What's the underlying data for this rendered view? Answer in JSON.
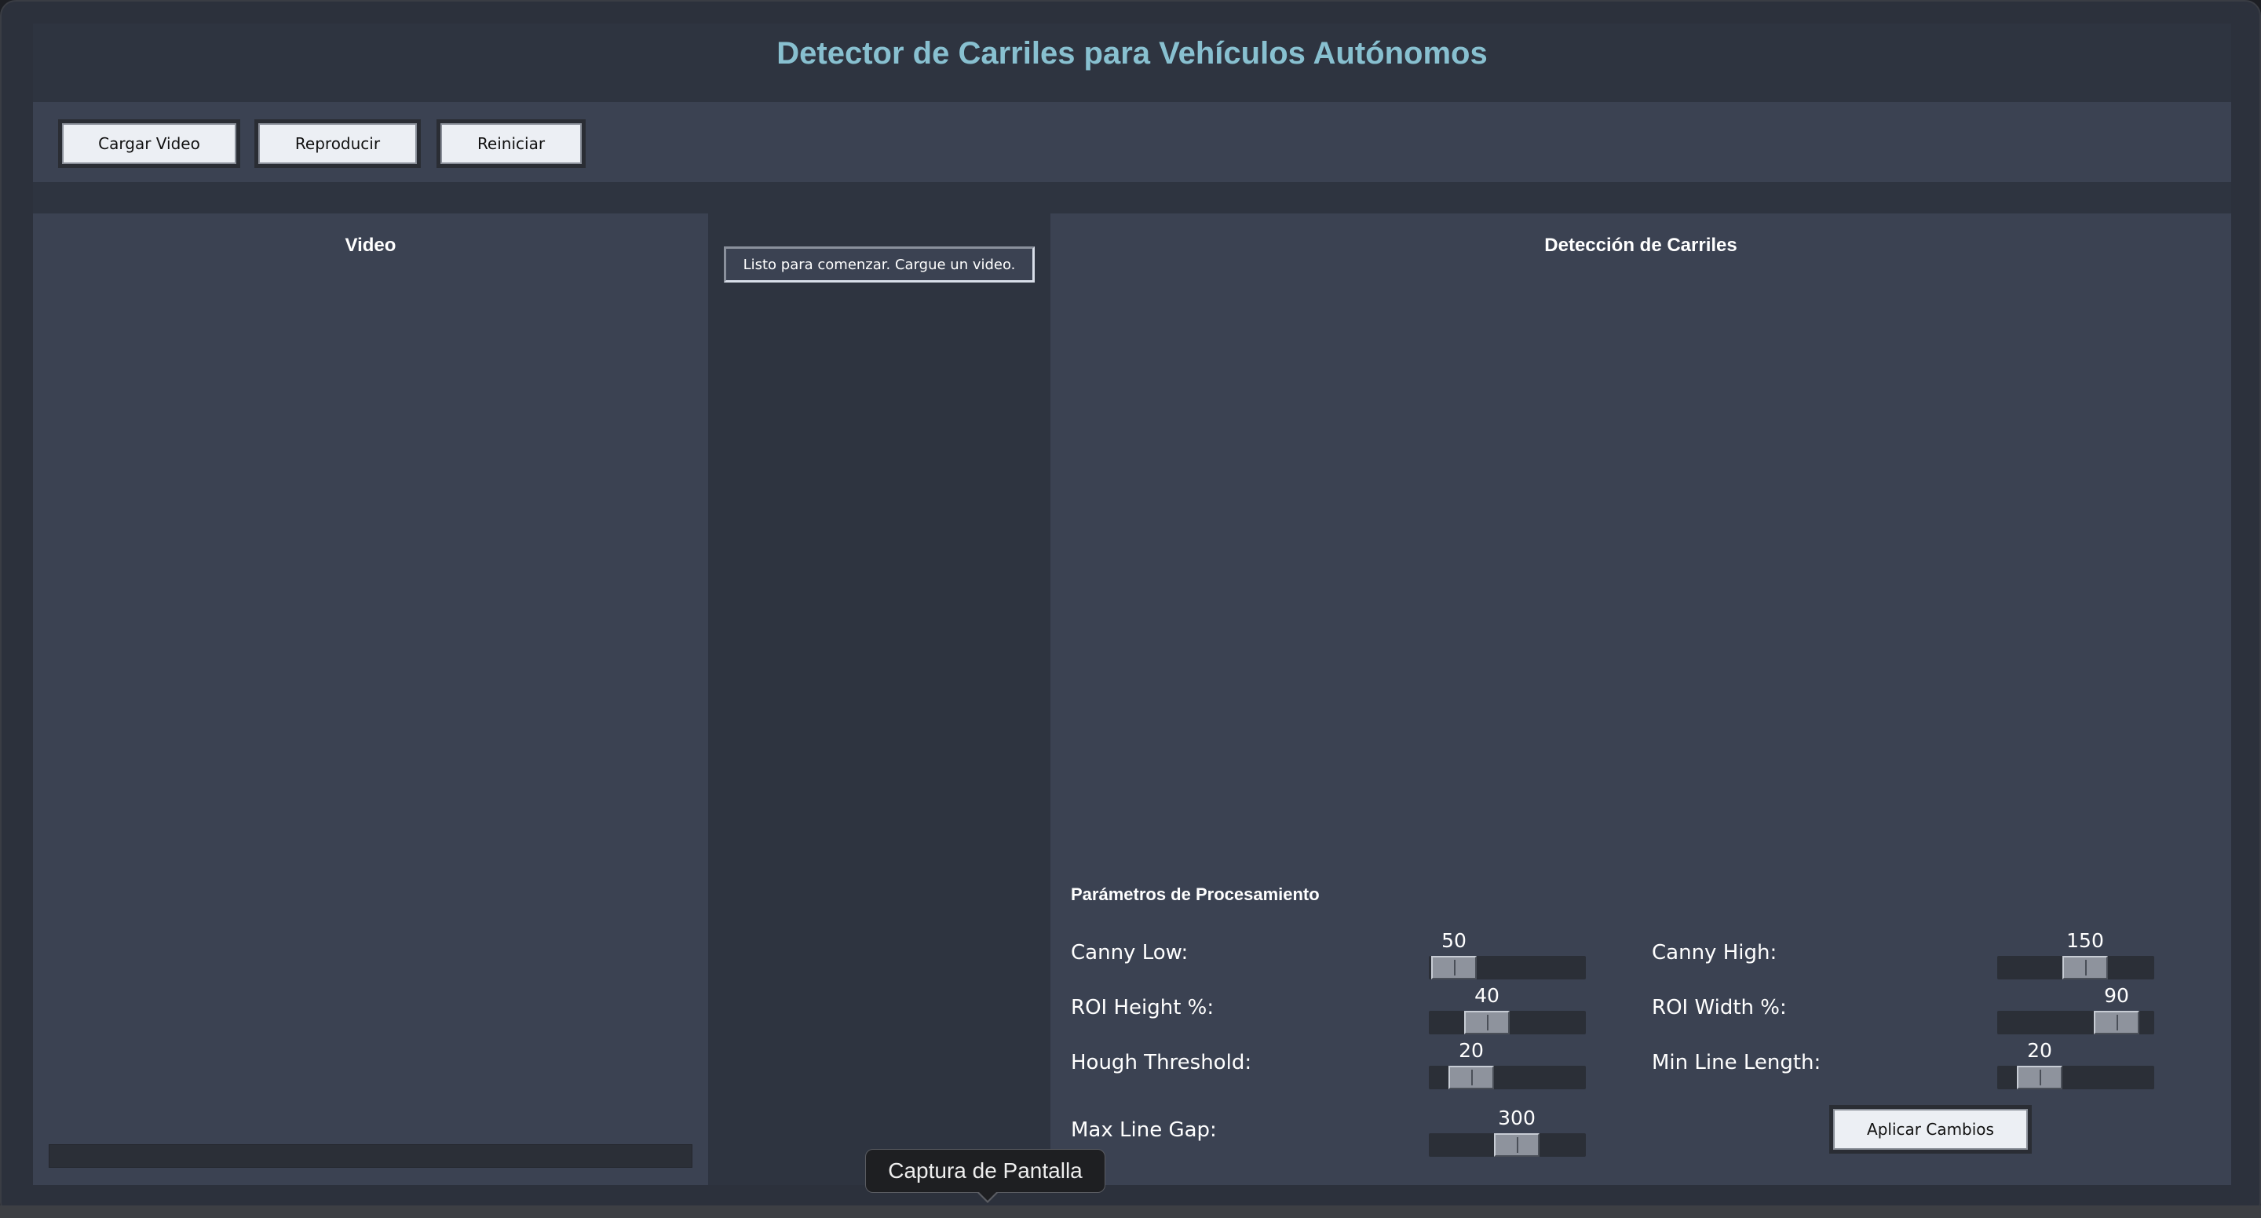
{
  "app": {
    "title": "Detector de Carriles para Vehículos Autónomos"
  },
  "toolbar": {
    "load_label": "Cargar Video",
    "play_label": "Reproducir",
    "reset_label": "Reiniciar"
  },
  "video_panel": {
    "title": "Video",
    "progress": 0
  },
  "status": {
    "text": "Listo para comenzar. Cargue un video."
  },
  "detection_panel": {
    "title": "Detección de Carriles"
  },
  "params": {
    "heading": "Parámetros de Procesamiento",
    "canny_low": {
      "label": "Canny Low:",
      "value": "50",
      "min": 0,
      "max": 255,
      "fraction": 0.16
    },
    "canny_high": {
      "label": "Canny High:",
      "value": "150",
      "min": 0,
      "max": 255,
      "fraction": 0.56
    },
    "roi_height": {
      "label": "ROI Height %:",
      "value": "40",
      "min": 0,
      "max": 100,
      "fraction": 0.37
    },
    "roi_width": {
      "label": "ROI Width %:",
      "value": "90",
      "min": 0,
      "max": 100,
      "fraction": 0.76
    },
    "hough_threshold": {
      "label": "Hough Threshold:",
      "value": "20",
      "min": 0,
      "max": 200,
      "fraction": 0.27
    },
    "min_line_length": {
      "label": "Min Line Length:",
      "value": "20",
      "min": 0,
      "max": 200,
      "fraction": 0.27
    },
    "max_line_gap": {
      "label": "Max Line Gap:",
      "value": "300",
      "min": 0,
      "max": 500,
      "fraction": 0.56
    },
    "apply_label": "Aplicar Cambios"
  },
  "tooltip": {
    "text": "Captura de Pantalla"
  }
}
